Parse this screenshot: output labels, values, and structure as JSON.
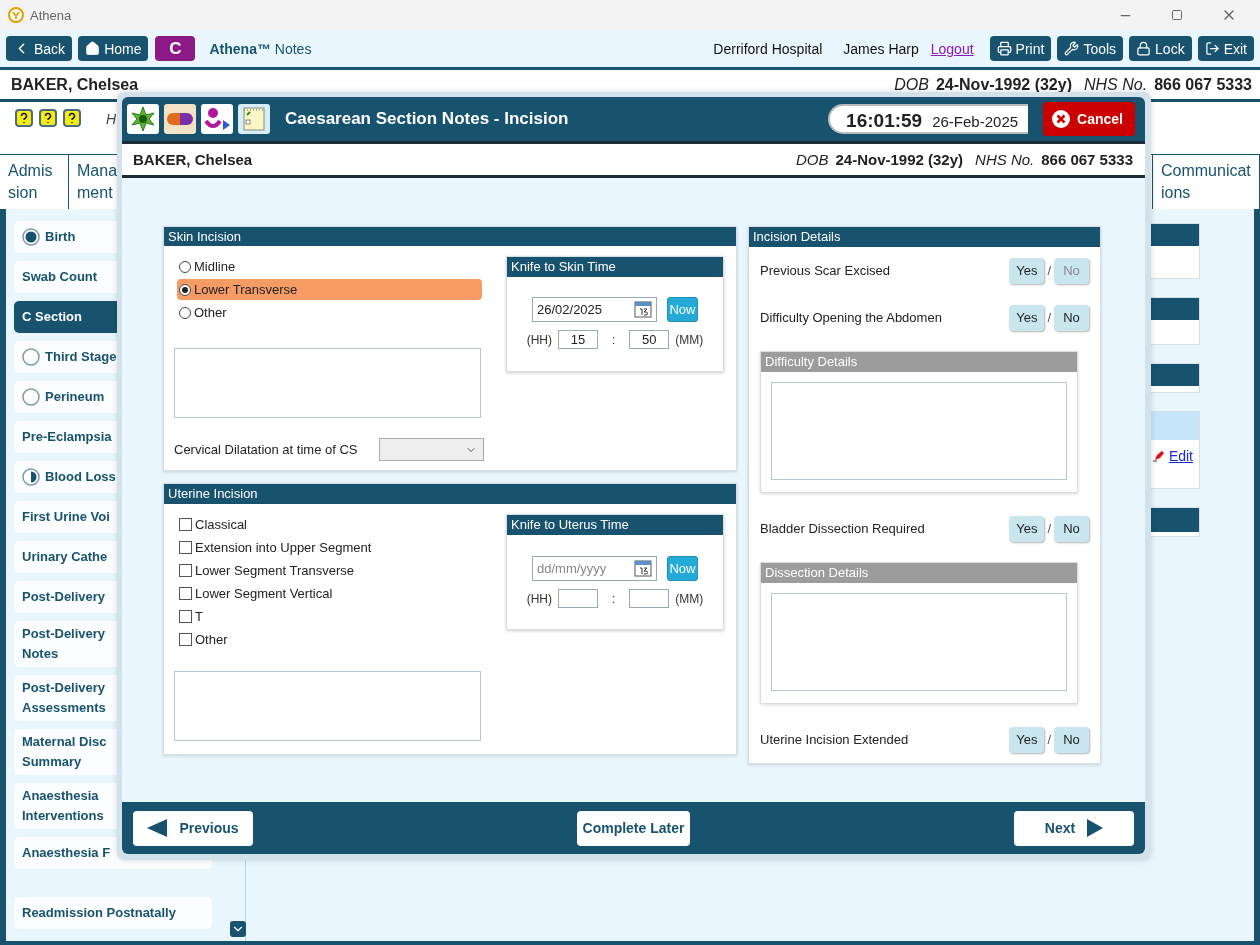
{
  "window": {
    "title": "Athena"
  },
  "toolbar": {
    "nav_buttons": [
      {
        "label": "Back"
      },
      {
        "label": "Home"
      }
    ],
    "app_badge": "C",
    "app_title": "**Athena™** Notes",
    "location": "Derriford Hospital",
    "user": "James Harp",
    "logout": "Logout",
    "actions": [
      {
        "label": "Print"
      },
      {
        "label": "Tools"
      },
      {
        "label": "Lock"
      },
      {
        "label": "Exit"
      }
    ]
  },
  "patient": {
    "name": "BAKER, Chelsea",
    "dob_label": "DOB",
    "dob": "24-Nov-1992 (32y)",
    "nhs_label": "NHS No.",
    "nhs": "866 067 5333"
  },
  "hint_text": "H",
  "tabs": [
    {
      "label": "Admission"
    },
    {
      "label": "Mana ment"
    },
    {
      "label": "Communications"
    }
  ],
  "sidebar": {
    "items": [
      {
        "label": "Birth",
        "kind": "complete",
        "selected": false
      },
      {
        "label": "Swab Count",
        "kind": "plain",
        "selected": false
      },
      {
        "label": "C Section",
        "kind": "plain",
        "selected": true
      },
      {
        "label": "Third Stage",
        "kind": "pending",
        "selected": false
      },
      {
        "label": "Perineum",
        "kind": "pending",
        "selected": false
      },
      {
        "label": "Pre-Eclampsia",
        "kind": "plain",
        "selected": false
      },
      {
        "label": "Blood Loss",
        "kind": "partial",
        "selected": false
      },
      {
        "label": "First Urine Voi",
        "kind": "plain",
        "selected": false
      },
      {
        "label": "Urinary Cathe",
        "kind": "plain",
        "selected": false
      },
      {
        "label": "Post-Delivery",
        "kind": "plain",
        "selected": false
      },
      {
        "label": "Post-Delivery Notes",
        "kind": "plain",
        "selected": false
      },
      {
        "label": "Post-Delivery Assessments",
        "kind": "plain",
        "selected": false
      },
      {
        "label": "Maternal Disc Summary",
        "kind": "plain",
        "selected": false
      },
      {
        "label": "Anaesthesia Interventions",
        "kind": "plain",
        "selected": false
      },
      {
        "label": "Anaesthesia F",
        "kind": "plain",
        "selected": false
      },
      {
        "label": "Readmission Postnatally",
        "kind": "plain",
        "selected": false,
        "detached": true
      }
    ]
  },
  "side_panel": {
    "edit_link": "Edit"
  },
  "modal": {
    "title": "Caesarean Section Notes - Incision",
    "clock_time": "16:01:59",
    "clock_date": "26-Feb-2025",
    "cancel": "Cancel",
    "patient": {
      "name": "BAKER, Chelsea",
      "dob_label": "DOB",
      "dob": "24-Nov-1992 (32y)",
      "nhs_label": "NHS No.",
      "nhs": "866 067 5333"
    },
    "skin_incision": {
      "title": "Skin Incision",
      "options": [
        {
          "label": "Midline",
          "selected": false
        },
        {
          "label": "Lower Transverse",
          "selected": true
        },
        {
          "label": "Other",
          "selected": false
        }
      ],
      "cervical_label": "Cervical Dilatation at time of CS",
      "time": {
        "title": "Knife to Skin Time",
        "date": "26/02/2025",
        "now": "Now",
        "hh_label": "(HH)",
        "hh": "15",
        "sep": ":",
        "mm": "50",
        "mm_label": "(MM)"
      }
    },
    "uterine_incision": {
      "title": "Uterine Incision",
      "options": [
        {
          "label": "Classical",
          "checked": false
        },
        {
          "label": "Extension into Upper Segment",
          "checked": false
        },
        {
          "label": "Lower Segment Transverse",
          "checked": false
        },
        {
          "label": "Lower Segment Vertical",
          "checked": false
        },
        {
          "label": "T",
          "checked": false
        },
        {
          "label": "Other",
          "checked": false
        }
      ],
      "time": {
        "title": "Knife to Uterus Time",
        "date_placeholder": "dd/mm/yyyy",
        "now": "Now",
        "hh_label": "(HH)",
        "sep": ":",
        "mm_label": "(MM)"
      }
    },
    "incision_details": {
      "title": "Incision Details",
      "rows": [
        {
          "kind": "question",
          "label": "Previous Scar Excised",
          "yes": "Yes",
          "no": "No",
          "sep": "/",
          "yes_selected": false,
          "no_selected": false,
          "no_disabled": true
        },
        {
          "kind": "question",
          "label": "Difficulty Opening the Abdomen",
          "yes": "Yes",
          "no": "No",
          "sep": "/",
          "yes_selected": false,
          "no_selected": false,
          "no_disabled": false
        },
        {
          "kind": "details",
          "title": "Difficulty Details",
          "disabled": true
        },
        {
          "kind": "question",
          "label": "Bladder Dissection Required",
          "yes": "Yes",
          "no": "No",
          "sep": "/",
          "yes_selected": false,
          "no_selected": false,
          "no_disabled": false
        },
        {
          "kind": "details",
          "title": "Dissection Details",
          "disabled": true
        },
        {
          "kind": "question",
          "label": "Uterine Incision Extended",
          "yes": "Yes",
          "no": "No",
          "sep": "/",
          "yes_selected": false,
          "no_selected": false,
          "no_disabled": false
        }
      ]
    },
    "footer": {
      "previous": "Previous",
      "complete_later": "Complete Later",
      "next": "Next"
    }
  }
}
